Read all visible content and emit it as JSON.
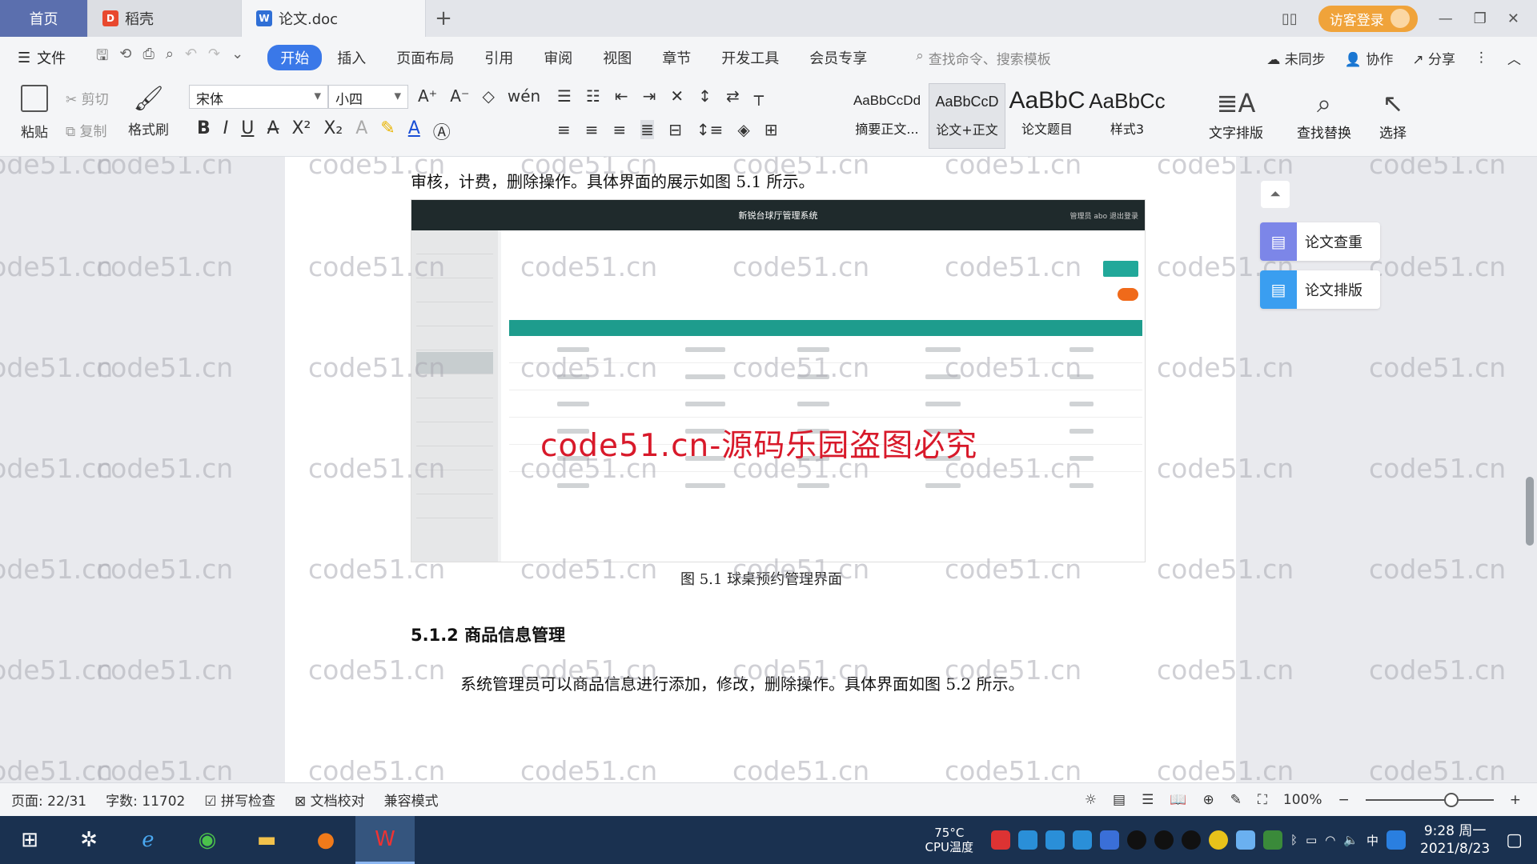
{
  "tabs": {
    "home": "首页",
    "daoke": "稻壳",
    "doc": "论文.doc",
    "new_tab": "+"
  },
  "header_right": {
    "login": "访客登录"
  },
  "menu": {
    "file": "文件",
    "items": [
      "开始",
      "插入",
      "页面布局",
      "引用",
      "审阅",
      "视图",
      "章节",
      "开发工具",
      "会员专享"
    ],
    "search_placeholder": "查找命令、搜索模板",
    "sync": "未同步",
    "collab": "协作",
    "share": "分享"
  },
  "ribbon": {
    "paste": "粘贴",
    "cut": "剪切",
    "copy": "复制",
    "format_painter": "格式刷",
    "font_name": "宋体",
    "font_size": "小四",
    "styles": [
      {
        "preview": "AaBbCcDd",
        "label": "摘要正文..."
      },
      {
        "preview": "AaBbCcD",
        "label": "论文+正文"
      },
      {
        "preview": "AaBbC",
        "label": "论文题目"
      },
      {
        "preview": "AaBbCc",
        "label": "样式3"
      }
    ],
    "text_layout": "文字排版",
    "find_replace": "查找替换",
    "select": "选择"
  },
  "document": {
    "line_top": "审核，计费，删除操作。具体界面的展示如图 5.1 所示。",
    "figure_caption": "图 5.1  球桌预约管理界面",
    "figure_title": "新锐台球厅管理系统",
    "figure_user": "管理员 abo   退出登录",
    "overlay_watermark": "code51.cn-源码乐园盗图必究",
    "section_heading": "5.1.2  商品信息管理",
    "para": "系统管理员可以商品信息进行添加，修改，删除操作。具体界面如图 5.2 所示。",
    "watermark": "code51.cn"
  },
  "side_panel": {
    "check": "论文查重",
    "layout": "论文排版"
  },
  "statusbar": {
    "page": "页面: 22/31",
    "words": "字数: 11702",
    "spell": "拼写检查",
    "proof": "文档校对",
    "compat": "兼容模式",
    "zoom": "100%"
  },
  "taskbar": {
    "cpu_temp": "75°C",
    "cpu_label": "CPU温度",
    "ime": "中",
    "time": "9:28 周一",
    "date": "2021/8/23"
  }
}
